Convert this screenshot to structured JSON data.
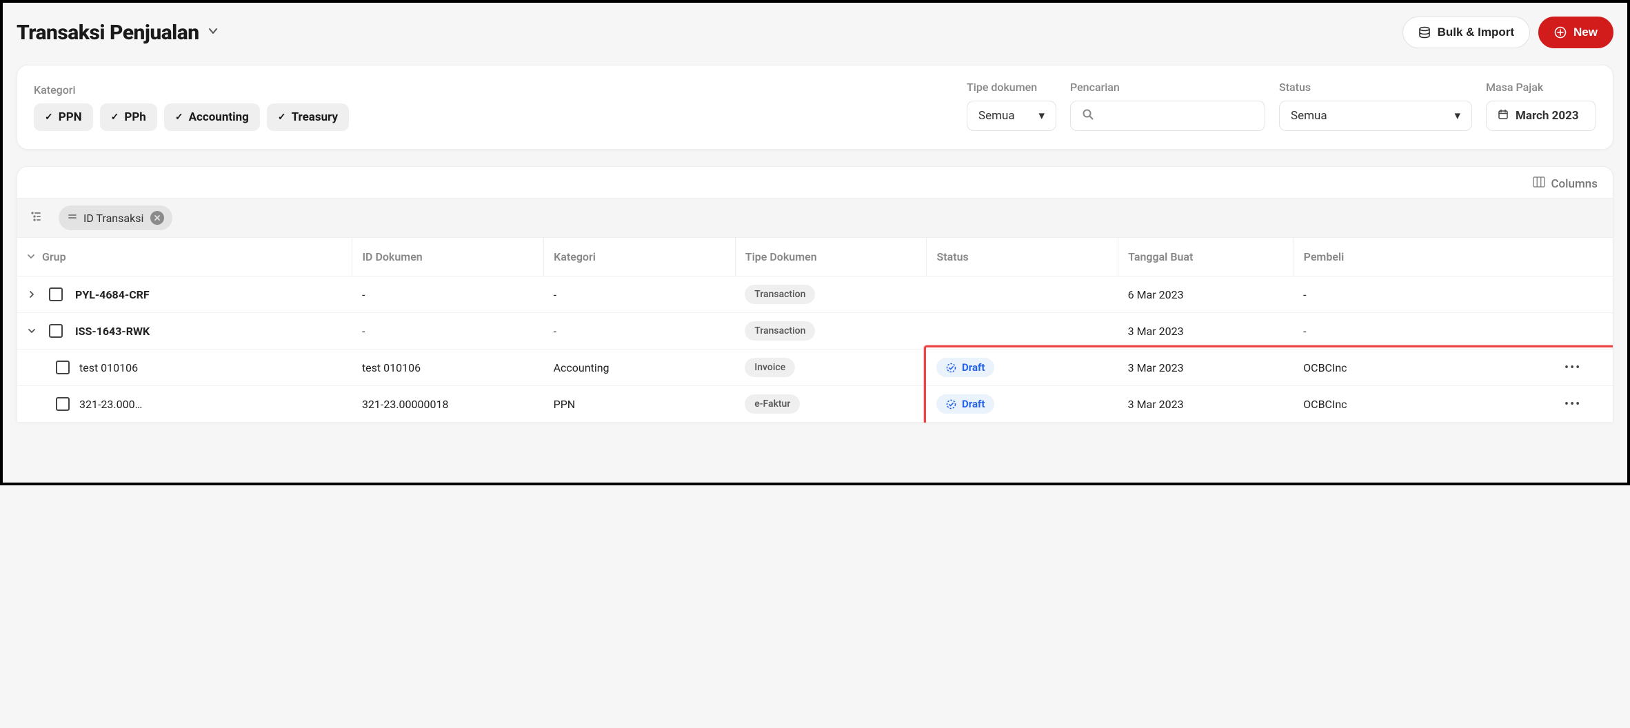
{
  "header": {
    "title": "Transaksi Penjualan",
    "bulk_import": "Bulk & Import",
    "new_btn": "New"
  },
  "filters": {
    "kategori_label": "Kategori",
    "kategori_chips": [
      "PPN",
      "PPh",
      "Accounting",
      "Treasury"
    ],
    "tipe_label": "Tipe dokumen",
    "tipe_value": "Semua",
    "pencarian_label": "Pencarian",
    "pencarian_value": "",
    "status_label": "Status",
    "status_value": "Semua",
    "masa_label": "Masa Pajak",
    "masa_value": "March 2023"
  },
  "table_ctrl": {
    "columns_btn": "Columns",
    "group_by_chip": "ID Transaksi"
  },
  "columns": {
    "grup": "Grup",
    "id_dokumen": "ID Dokumen",
    "kategori": "Kategori",
    "tipe_dokumen": "Tipe Dokumen",
    "status": "Status",
    "tanggal_buat": "Tanggal Buat",
    "pembeli": "Pembeli"
  },
  "rows": [
    {
      "level": "parent",
      "expanded": false,
      "grup": "PYL-4684-CRF",
      "id_dokumen": "-",
      "kategori": "-",
      "tipe": "Transaction",
      "status": "",
      "tanggal": "6 Mar 2023",
      "pembeli": "-"
    },
    {
      "level": "parent",
      "expanded": true,
      "grup": "ISS-1643-RWK",
      "id_dokumen": "-",
      "kategori": "-",
      "tipe": "Transaction",
      "status": "",
      "tanggal": "3 Mar 2023",
      "pembeli": "-"
    },
    {
      "level": "child",
      "grup": "test 010106",
      "id_dokumen": "test 010106",
      "kategori": "Accounting",
      "tipe": "Invoice",
      "status": "Draft",
      "tanggal": "3 Mar 2023",
      "pembeli": "OCBCInc"
    },
    {
      "level": "child",
      "grup": "321-23.000…",
      "id_dokumen": "321-23.00000018",
      "kategori": "PPN",
      "tipe": "e-Faktur",
      "status": "Draft",
      "tanggal": "3 Mar 2023",
      "pembeli": "OCBCInc"
    }
  ]
}
